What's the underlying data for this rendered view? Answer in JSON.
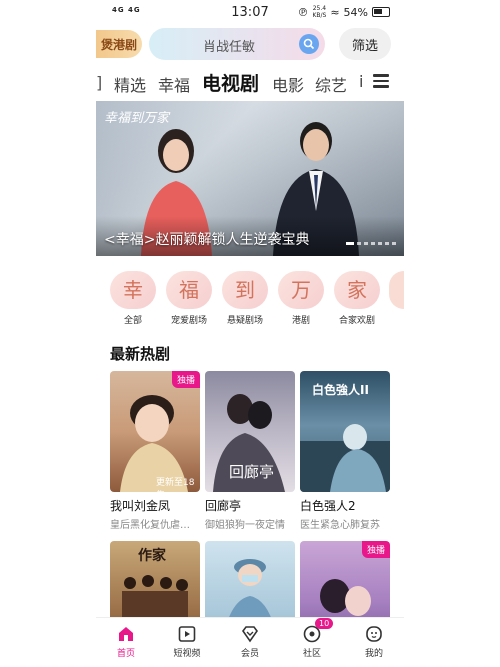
{
  "status_bar": {
    "network": "4G 4G",
    "time": "13:07",
    "speed": "25.4",
    "speed_unit": "KB/S",
    "battery": "54%"
  },
  "header": {
    "brand_label": "煲港剧",
    "search_placeholder": "肖战任敏",
    "filter_label": "筛选"
  },
  "tabs": {
    "edge_left": "]",
    "items": [
      "精选",
      "幸福",
      "电视剧",
      "电影",
      "综艺",
      "i"
    ],
    "active": "电视剧"
  },
  "banner": {
    "logo_text": "幸福到万家",
    "caption": "<幸福>赵丽颖解锁人生逆袭宝典"
  },
  "categories": [
    {
      "char": "幸",
      "label": "全部"
    },
    {
      "char": "福",
      "label": "宠爱剧场"
    },
    {
      "char": "到",
      "label": "悬疑剧场"
    },
    {
      "char": "万",
      "label": "港剧"
    },
    {
      "char": "家",
      "label": "合家欢剧"
    }
  ],
  "section": {
    "title": "最新热剧"
  },
  "cards": [
    {
      "title": "我叫刘金凤",
      "desc": "皇后黑化复仇虐…",
      "badge": "独播",
      "poster_text": "更新至18集"
    },
    {
      "title": "回廊亭",
      "desc": "御姐狼狗一夜定情",
      "badge": "",
      "poster_text": "回廊亭"
    },
    {
      "title": "白色强人2",
      "desc": "医生紧急心肺复苏",
      "badge": "",
      "poster_text": "白色強人II"
    },
    {
      "title": "",
      "desc": "",
      "badge": "",
      "poster_text": "作家"
    },
    {
      "title": "",
      "desc": "",
      "badge": "",
      "poster_text": ""
    },
    {
      "title": "",
      "desc": "",
      "badge": "独播",
      "poster_text": ""
    }
  ],
  "bottom_nav": {
    "items": [
      "首页",
      "短视频",
      "会员",
      "社区",
      "我的"
    ],
    "community_badge": "10"
  },
  "colors": {
    "accent": "#e8178a",
    "category_text": "#d4735c"
  }
}
